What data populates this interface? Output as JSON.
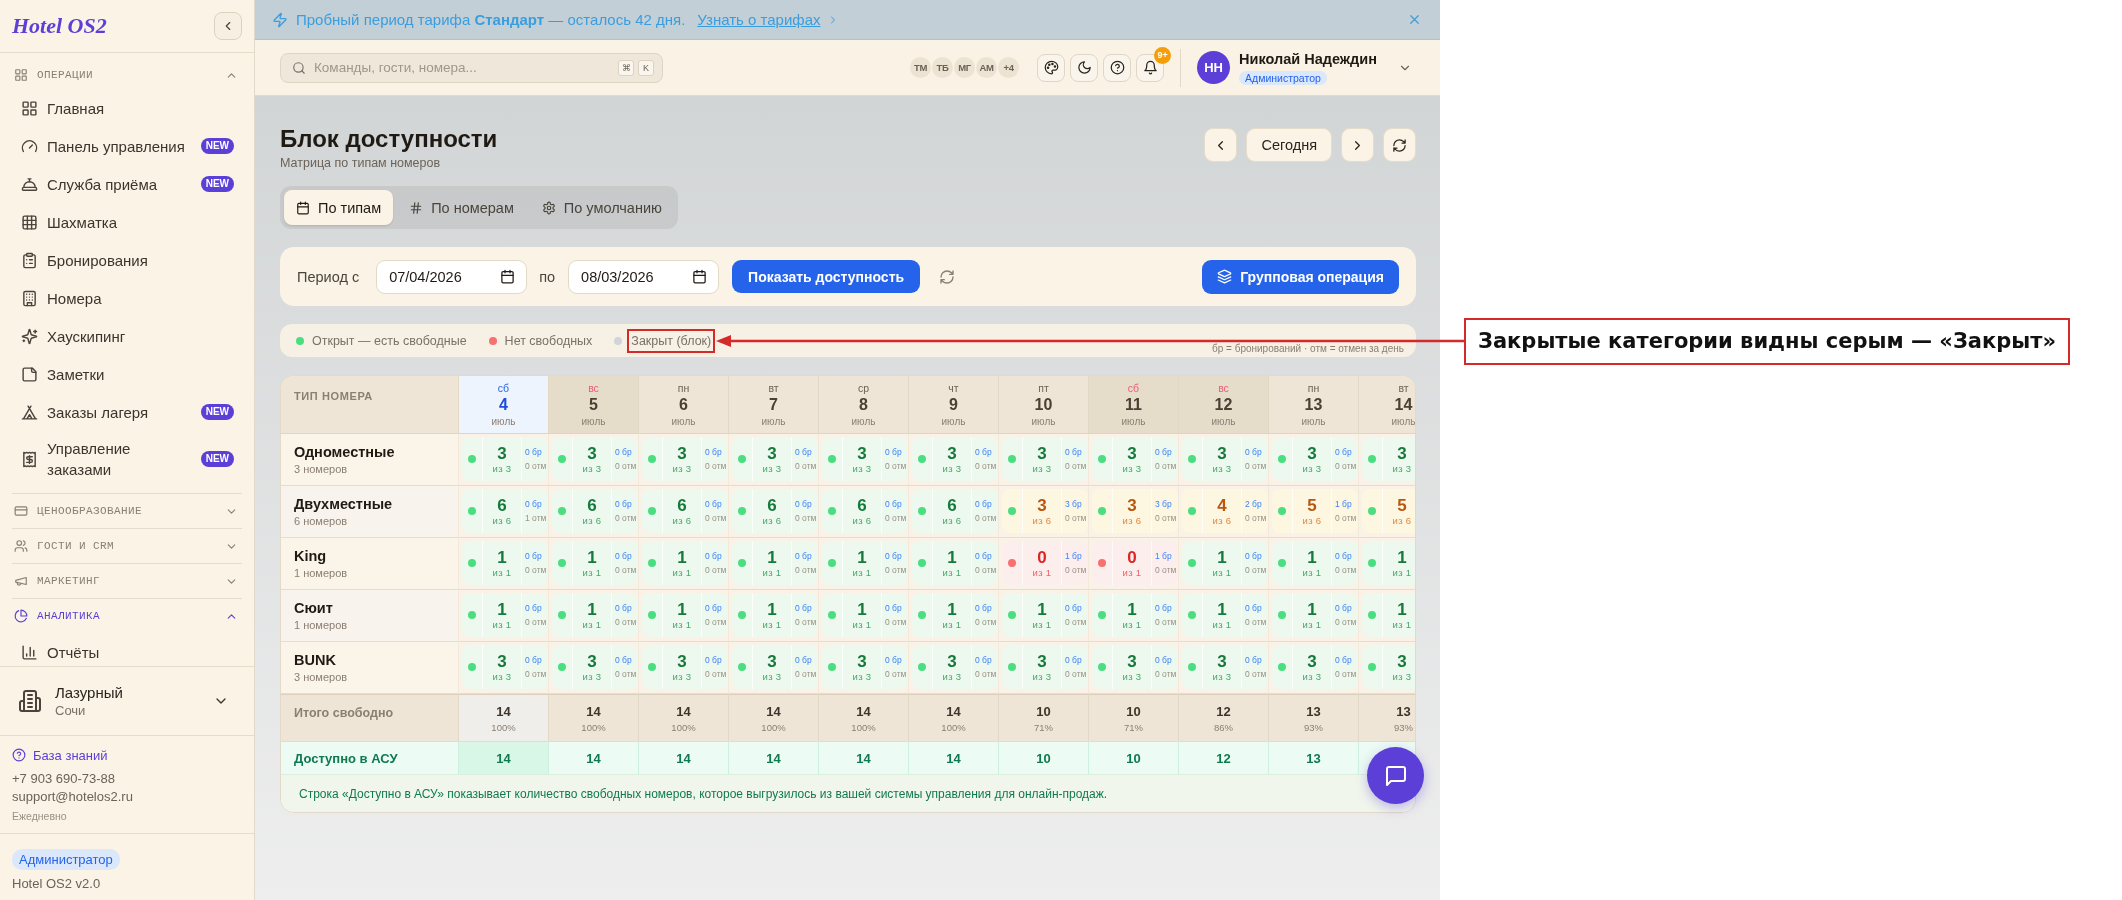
{
  "sidebar": {
    "logo": "Hotel OS2",
    "groups": [
      {
        "label": "ОПЕРАЦИИ",
        "expanded": true,
        "active": false,
        "items": [
          {
            "label": "Главная"
          },
          {
            "label": "Панель управления",
            "badge": "NEW"
          },
          {
            "label": "Служба приёма",
            "badge": "NEW"
          },
          {
            "label": "Шахматка"
          },
          {
            "label": "Бронирования"
          },
          {
            "label": "Номера"
          },
          {
            "label": "Хаускипинг"
          },
          {
            "label": "Заметки"
          },
          {
            "label": "Заказы лагеря",
            "badge": "NEW"
          },
          {
            "label": "Управление заказами",
            "badge": "NEW"
          }
        ]
      },
      {
        "label": "ЦЕНООБРАЗОВАНИЕ",
        "expanded": false,
        "active": false
      },
      {
        "label": "ГОСТИ И CRM",
        "expanded": false,
        "active": false
      },
      {
        "label": "МАРКЕТИНГ",
        "expanded": false,
        "active": false
      },
      {
        "label": "АНАЛИТИКА",
        "expanded": true,
        "active": true,
        "items": [
          {
            "label": "Отчёты"
          }
        ]
      }
    ],
    "hotel": {
      "name": "Лазурный",
      "city": "Сочи"
    },
    "support": {
      "link": "База знаний",
      "phone": "+7 903 690-73-88",
      "email": "support@hotelos2.ru",
      "hours": "Ежедневно"
    },
    "role": "Администратор",
    "version": "Hotel OS2 v2.0"
  },
  "banner": {
    "text": "Пробный период тарифа **Стандарт** — осталось 42 дня.",
    "link": "Узнать о тарифах"
  },
  "header": {
    "search": {
      "placeholder": "Команды, гости, номера...",
      "keys": [
        "⌘",
        "K"
      ]
    },
    "presence": [
      "ТМ",
      "ТБ",
      "МГ",
      "АМ",
      "+4"
    ],
    "notifications": "9+",
    "user": {
      "initials": "НН",
      "name": "Николай Надеждин",
      "role": "Администратор"
    }
  },
  "page": {
    "title": "Блок доступности",
    "subtitle": "Матрица по типам номеров",
    "today": "Сегодня"
  },
  "tabs": [
    {
      "label": "По типам",
      "selected": true
    },
    {
      "label": "По номерам",
      "selected": false
    },
    {
      "label": "По умолчанию",
      "selected": false
    }
  ],
  "filter": {
    "from_label": "Период с",
    "from": "07/04/2026",
    "to_label": "по",
    "to": "08/03/2026",
    "submit": "Показать доступность",
    "bulk": "Групповая операция"
  },
  "legend": {
    "items": [
      {
        "label": "Открыт — есть свободные",
        "color": "#4ade80",
        "highlighted": false
      },
      {
        "label": "Нет свободных",
        "color": "#f87171",
        "highlighted": false
      },
      {
        "label": "Закрыт (блок)",
        "color": "#d1d5db",
        "highlighted": true
      }
    ],
    "note": "бр = бронирований · отм = отмен за день"
  },
  "table": {
    "corner": "ТИП НОМЕРА",
    "days": [
      {
        "weekday": "сб",
        "day": "4",
        "month": "июль",
        "weekend": true,
        "today": true
      },
      {
        "weekday": "вс",
        "day": "5",
        "month": "июль",
        "weekend": true,
        "today": false
      },
      {
        "weekday": "пн",
        "day": "6",
        "month": "июль",
        "weekend": false,
        "today": false
      },
      {
        "weekday": "вт",
        "day": "7",
        "month": "июль",
        "weekend": false,
        "today": false
      },
      {
        "weekday": "ср",
        "day": "8",
        "month": "июль",
        "weekend": false,
        "today": false
      },
      {
        "weekday": "чт",
        "day": "9",
        "month": "июль",
        "weekend": false,
        "today": false
      },
      {
        "weekday": "пт",
        "day": "10",
        "month": "июль",
        "weekend": false,
        "today": false
      },
      {
        "weekday": "сб",
        "day": "11",
        "month": "июль",
        "weekend": true,
        "today": false
      },
      {
        "weekday": "вс",
        "day": "12",
        "month": "июль",
        "weekend": true,
        "today": false
      },
      {
        "weekday": "пн",
        "day": "13",
        "month": "июль",
        "weekend": false,
        "today": false
      },
      {
        "weekday": "вт",
        "day": "14",
        "month": "июль",
        "weekend": false,
        "today": false
      }
    ],
    "rows": [
      {
        "name": "Одноместные",
        "count": "3 номеров",
        "cells": [
          {
            "kind": "free",
            "free": "3",
            "total": "из 3",
            "booked": "0 бр",
            "cancelled": "0 отм"
          },
          {
            "kind": "free",
            "free": "3",
            "total": "из 3",
            "booked": "0 бр",
            "cancelled": "0 отм"
          },
          {
            "kind": "free",
            "free": "3",
            "total": "из 3",
            "booked": "0 бр",
            "cancelled": "0 отм"
          },
          {
            "kind": "free",
            "free": "3",
            "total": "из 3",
            "booked": "0 бр",
            "cancelled": "0 отм"
          },
          {
            "kind": "free",
            "free": "3",
            "total": "из 3",
            "booked": "0 бр",
            "cancelled": "0 отм"
          },
          {
            "kind": "free",
            "free": "3",
            "total": "из 3",
            "booked": "0 бр",
            "cancelled": "0 отм"
          },
          {
            "kind": "free",
            "free": "3",
            "total": "из 3",
            "booked": "0 бр",
            "cancelled": "0 отм"
          },
          {
            "kind": "free",
            "free": "3",
            "total": "из 3",
            "booked": "0 бр",
            "cancelled": "0 отм"
          },
          {
            "kind": "free",
            "free": "3",
            "total": "из 3",
            "booked": "0 бр",
            "cancelled": "0 отм"
          },
          {
            "kind": "free",
            "free": "3",
            "total": "из 3",
            "booked": "0 бр",
            "cancelled": "0 отм"
          },
          {
            "kind": "free",
            "free": "3",
            "total": "из 3"
          }
        ]
      },
      {
        "name": "Двухместные",
        "count": "6 номеров",
        "cells": [
          {
            "kind": "free",
            "free": "6",
            "total": "из 6",
            "booked": "0 бр",
            "cancelled": "1 отм"
          },
          {
            "kind": "free",
            "free": "6",
            "total": "из 6",
            "booked": "0 бр",
            "cancelled": "0 отм"
          },
          {
            "kind": "free",
            "free": "6",
            "total": "из 6",
            "booked": "0 бр",
            "cancelled": "0 отм"
          },
          {
            "kind": "free",
            "free": "6",
            "total": "из 6",
            "booked": "0 бр",
            "cancelled": "0 отм"
          },
          {
            "kind": "free",
            "free": "6",
            "total": "из 6",
            "booked": "0 бр",
            "cancelled": "0 отм"
          },
          {
            "kind": "free",
            "free": "6",
            "total": "из 6",
            "booked": "0 бр",
            "cancelled": "0 отм"
          },
          {
            "kind": "partial",
            "free": "3",
            "total": "из 6",
            "booked": "3 бр",
            "cancelled": "0 отм"
          },
          {
            "kind": "partial",
            "free": "3",
            "total": "из 6",
            "booked": "3 бр",
            "cancelled": "0 отм"
          },
          {
            "kind": "partial",
            "free": "4",
            "total": "из 6",
            "booked": "2 бр",
            "cancelled": "0 отм"
          },
          {
            "kind": "partial",
            "free": "5",
            "total": "из 6",
            "booked": "1 бр",
            "cancelled": "0 отм"
          },
          {
            "kind": "partial",
            "free": "5",
            "total": "из 6"
          }
        ]
      },
      {
        "name": "King",
        "count": "1 номеров",
        "cells": [
          {
            "kind": "free",
            "free": "1",
            "total": "из 1",
            "booked": "0 бр",
            "cancelled": "0 отм"
          },
          {
            "kind": "free",
            "free": "1",
            "total": "из 1",
            "booked": "0 бр",
            "cancelled": "0 отм"
          },
          {
            "kind": "free",
            "free": "1",
            "total": "из 1",
            "booked": "0 бр",
            "cancelled": "0 отм"
          },
          {
            "kind": "free",
            "free": "1",
            "total": "из 1",
            "booked": "0 бр",
            "cancelled": "0 отм"
          },
          {
            "kind": "free",
            "free": "1",
            "total": "из 1",
            "booked": "0 бр",
            "cancelled": "0 отм"
          },
          {
            "kind": "free",
            "free": "1",
            "total": "из 1",
            "booked": "0 бр",
            "cancelled": "0 отм"
          },
          {
            "kind": "sold_out",
            "free": "0",
            "total": "из 1",
            "booked": "1 бр",
            "cancelled": "0 отм"
          },
          {
            "kind": "sold_out",
            "free": "0",
            "total": "из 1",
            "booked": "1 бр",
            "cancelled": "0 отм"
          },
          {
            "kind": "free",
            "free": "1",
            "total": "из 1",
            "booked": "0 бр",
            "cancelled": "0 отм"
          },
          {
            "kind": "free",
            "free": "1",
            "total": "из 1",
            "booked": "0 бр",
            "cancelled": "0 отм"
          },
          {
            "kind": "free",
            "free": "1",
            "total": "из 1"
          }
        ]
      },
      {
        "name": "Сюит",
        "count": "1 номеров",
        "cells": [
          {
            "kind": "free",
            "free": "1",
            "total": "из 1",
            "booked": "0 бр",
            "cancelled": "0 отм"
          },
          {
            "kind": "free",
            "free": "1",
            "total": "из 1",
            "booked": "0 бр",
            "cancelled": "0 отм"
          },
          {
            "kind": "free",
            "free": "1",
            "total": "из 1",
            "booked": "0 бр",
            "cancelled": "0 отм"
          },
          {
            "kind": "free",
            "free": "1",
            "total": "из 1",
            "booked": "0 бр",
            "cancelled": "0 отм"
          },
          {
            "kind": "free",
            "free": "1",
            "total": "из 1",
            "booked": "0 бр",
            "cancelled": "0 отм"
          },
          {
            "kind": "free",
            "free": "1",
            "total": "из 1",
            "booked": "0 бр",
            "cancelled": "0 отм"
          },
          {
            "kind": "free",
            "free": "1",
            "total": "из 1",
            "booked": "0 бр",
            "cancelled": "0 отм"
          },
          {
            "kind": "free",
            "free": "1",
            "total": "из 1",
            "booked": "0 бр",
            "cancelled": "0 отм"
          },
          {
            "kind": "free",
            "free": "1",
            "total": "из 1",
            "booked": "0 бр",
            "cancelled": "0 отм"
          },
          {
            "kind": "free",
            "free": "1",
            "total": "из 1",
            "booked": "0 бр",
            "cancelled": "0 отм"
          },
          {
            "kind": "free",
            "free": "1",
            "total": "из 1"
          }
        ]
      },
      {
        "name": "BUNK",
        "count": "3 номеров",
        "cells": [
          {
            "kind": "free",
            "free": "3",
            "total": "из 3",
            "booked": "0 бр",
            "cancelled": "0 отм"
          },
          {
            "kind": "free",
            "free": "3",
            "total": "из 3",
            "booked": "0 бр",
            "cancelled": "0 отм"
          },
          {
            "kind": "free",
            "free": "3",
            "total": "из 3",
            "booked": "0 бр",
            "cancelled": "0 отм"
          },
          {
            "kind": "free",
            "free": "3",
            "total": "из 3",
            "booked": "0 бр",
            "cancelled": "0 отм"
          },
          {
            "kind": "free",
            "free": "3",
            "total": "из 3",
            "booked": "0 бр",
            "cancelled": "0 отм"
          },
          {
            "kind": "free",
            "free": "3",
            "total": "из 3",
            "booked": "0 бр",
            "cancelled": "0 отм"
          },
          {
            "kind": "free",
            "free": "3",
            "total": "из 3",
            "booked": "0 бр",
            "cancelled": "0 отм"
          },
          {
            "kind": "free",
            "free": "3",
            "total": "из 3",
            "booked": "0 бр",
            "cancelled": "0 отм"
          },
          {
            "kind": "free",
            "free": "3",
            "total": "из 3",
            "booked": "0 бр",
            "cancelled": "0 отм"
          },
          {
            "kind": "free",
            "free": "3",
            "total": "из 3",
            "booked": "0 бр",
            "cancelled": "0 отм"
          },
          {
            "kind": "free",
            "free": "3",
            "total": "из 3"
          }
        ]
      }
    ],
    "totals": {
      "label": "Итого свободно",
      "cells": [
        {
          "value": "14",
          "percent": "100%"
        },
        {
          "value": "14",
          "percent": "100%"
        },
        {
          "value": "14",
          "percent": "100%"
        },
        {
          "value": "14",
          "percent": "100%"
        },
        {
          "value": "14",
          "percent": "100%"
        },
        {
          "value": "14",
          "percent": "100%"
        },
        {
          "value": "10",
          "percent": "71%"
        },
        {
          "value": "10",
          "percent": "71%"
        },
        {
          "value": "12",
          "percent": "86%"
        },
        {
          "value": "13",
          "percent": "93%"
        },
        {
          "value": "13",
          "percent": "93%"
        }
      ]
    },
    "asu": {
      "label": "Доступно в АСУ",
      "values": [
        "14",
        "14",
        "14",
        "14",
        "14",
        "14",
        "10",
        "10",
        "12",
        "13"
      ]
    },
    "note": "Строка «Доступно в АСУ» показывает количество свободных номеров, которое выгрузилось из вашей системы управления для онлайн-продаж."
  },
  "annotation": {
    "text": "Закрытые категории видны серым — «Закрыт»"
  }
}
